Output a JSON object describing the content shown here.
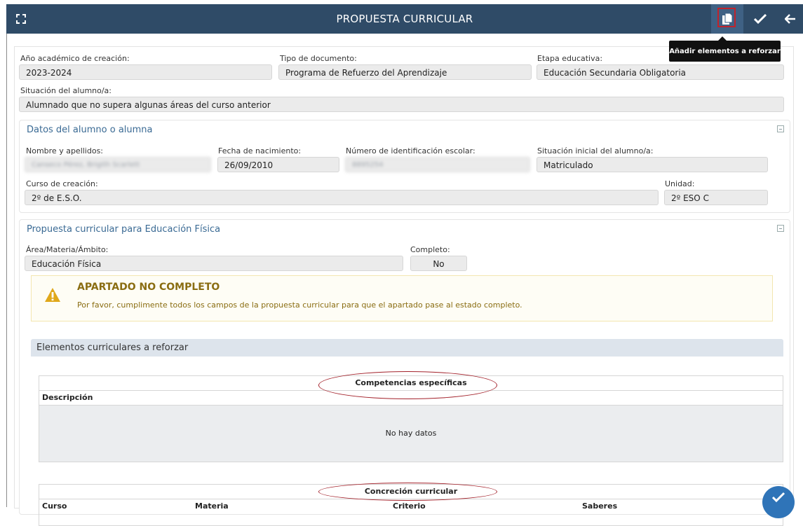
{
  "header": {
    "title": "PROPUESTA CURRICULAR",
    "tooltip": "Añadir elementos a reforzar",
    "icons": [
      "fullscreen-icon",
      "copy-icon",
      "check-icon",
      "arrow-left-icon"
    ],
    "accent_color": "#2f4b67",
    "highlight_color": "#c0232c"
  },
  "document": {
    "year_label": "Año académico de creación:",
    "year_value": "2023-2024",
    "type_label": "Tipo de documento:",
    "type_value": "Programa de Refuerzo del Aprendizaje",
    "stage_label": "Etapa educativa:",
    "stage_value": "Educación Secundaria Obligatoria",
    "situation_label": "Situación del alumno/a:",
    "situation_value": "Alumnado que no supera algunas áreas del curso anterior"
  },
  "student": {
    "title": "Datos del alumno o alumna",
    "name_label": "Nombre y apellidos:",
    "name_value": "Canseco Pérez, Brigith Scarlett",
    "birth_label": "Fecha de nacimiento:",
    "birth_value": "26/09/2010",
    "id_label": "Número de identificación escolar:",
    "id_value": "8895254",
    "initial_label": "Situación inicial del alumno/a:",
    "initial_value": "Matriculado",
    "course_label": "Curso de creación:",
    "course_value": "2º de E.S.O.",
    "unit_label": "Unidad:",
    "unit_value": "2º ESO C"
  },
  "proposal": {
    "title": "Propuesta curricular para Educación Física",
    "area_label": "Área/Materia/Ámbito:",
    "area_value": "Educación Física",
    "complete_label": "Completo:",
    "complete_value": "No",
    "alert_title": "APARTADO NO COMPLETO",
    "alert_message": "Por favor, cumplimente todos los campos de la propuesta curricular para que el apartado pase al estado completo."
  },
  "elements": {
    "title": "Elementos curriculares a reforzar",
    "competencias": {
      "caption": "Competencias específicas",
      "column": "Descripción",
      "empty": "No hay datos"
    },
    "concrecion": {
      "caption": "Concreción curricular",
      "columns": [
        "Curso",
        "Materia",
        "Criterio",
        "Saberes"
      ]
    }
  }
}
